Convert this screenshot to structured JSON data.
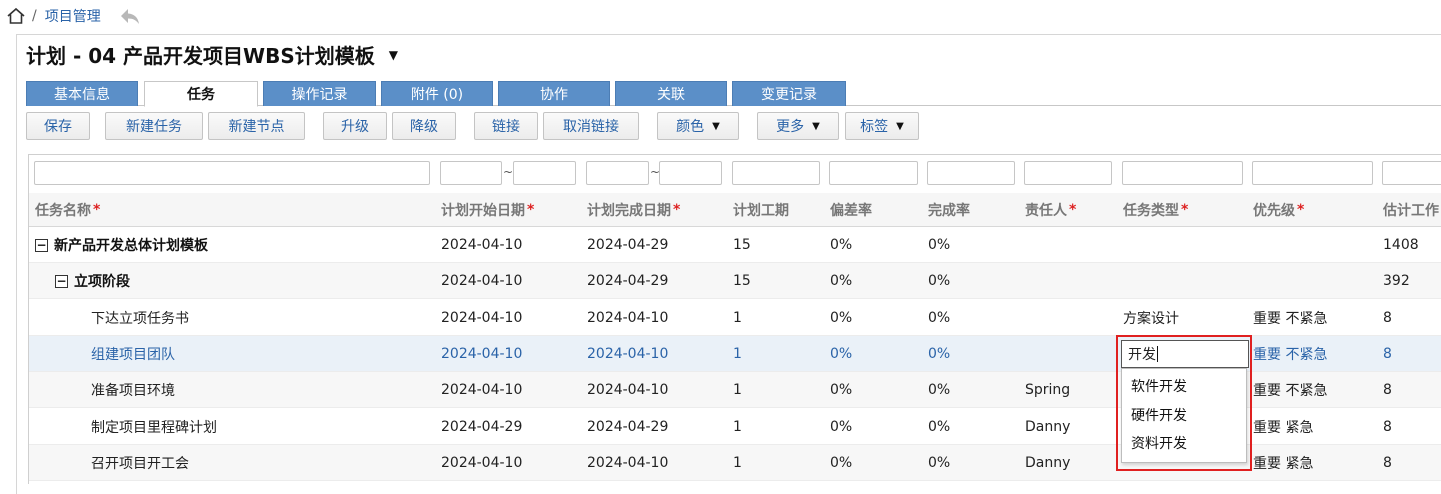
{
  "breadcrumb": {
    "separator": "/",
    "link": "项目管理"
  },
  "title": {
    "text": "计划 - 04 产品开发项目WBS计划模板"
  },
  "tabs": [
    "基本信息",
    "任务",
    "操作记录",
    "附件 (0)",
    "协作",
    "关联",
    "变更记录"
  ],
  "toolbar": {
    "save": "保存",
    "new_task": "新建任务",
    "new_node": "新建节点",
    "upgrade": "升级",
    "downgrade": "降级",
    "link": "链接",
    "unlink": "取消链接",
    "color": "颜色",
    "more": "更多",
    "tag": "标签"
  },
  "filter": {
    "tilde": "~"
  },
  "columns": {
    "name": "任务名称",
    "start": "计划开始日期",
    "end": "计划完成日期",
    "duration": "计划工期",
    "deviation": "偏差率",
    "completion": "完成率",
    "owner": "责任人",
    "type": "任务类型",
    "priority": "优先级",
    "estimate": "估计工作",
    "required_mark": "*"
  },
  "rows": [
    {
      "toggle": "−",
      "name": "新产品开发总体计划模板",
      "start": "2024-04-10",
      "end": "2024-04-29",
      "duration": "15",
      "deviation": "0%",
      "completion": "0%",
      "owner": "",
      "type": "",
      "priority": "",
      "estimate": "1408"
    },
    {
      "toggle": "−",
      "name": "立项阶段",
      "start": "2024-04-10",
      "end": "2024-04-29",
      "duration": "15",
      "deviation": "0%",
      "completion": "0%",
      "owner": "",
      "type": "",
      "priority": "",
      "estimate": "392"
    },
    {
      "name": "下达立项任务书",
      "start": "2024-04-10",
      "end": "2024-04-10",
      "duration": "1",
      "deviation": "0%",
      "completion": "0%",
      "owner": "",
      "type": "方案设计",
      "priority": "重要 不紧急",
      "estimate": "8"
    },
    {
      "name": "组建项目团队",
      "start": "2024-04-10",
      "end": "2024-04-10",
      "duration": "1",
      "deviation": "0%",
      "completion": "0%",
      "owner": "",
      "type": "",
      "priority": "重要 不紧急",
      "estimate": "8"
    },
    {
      "name": "准备项目环境",
      "start": "2024-04-10",
      "end": "2024-04-10",
      "duration": "1",
      "deviation": "0%",
      "completion": "0%",
      "owner": "Spring",
      "type": "",
      "priority": "重要 不紧急",
      "estimate": "8"
    },
    {
      "name": "制定项目里程碑计划",
      "start": "2024-04-29",
      "end": "2024-04-29",
      "duration": "1",
      "deviation": "0%",
      "completion": "0%",
      "owner": "Danny",
      "type": "",
      "priority": "重要 紧急",
      "estimate": "8"
    },
    {
      "name": "召开项目开工会",
      "start": "2024-04-10",
      "end": "2024-04-10",
      "duration": "1",
      "deviation": "0%",
      "completion": "0%",
      "owner": "Danny",
      "type": "",
      "priority": "重要 紧急",
      "estimate": "8"
    }
  ],
  "editor": {
    "value": "开发",
    "options": [
      "软件开发",
      "硬件开发",
      "资料开发"
    ]
  },
  "colors": {
    "accent": "#5b8fc8",
    "link": "#2a63a8",
    "highlight": "#e02020"
  }
}
